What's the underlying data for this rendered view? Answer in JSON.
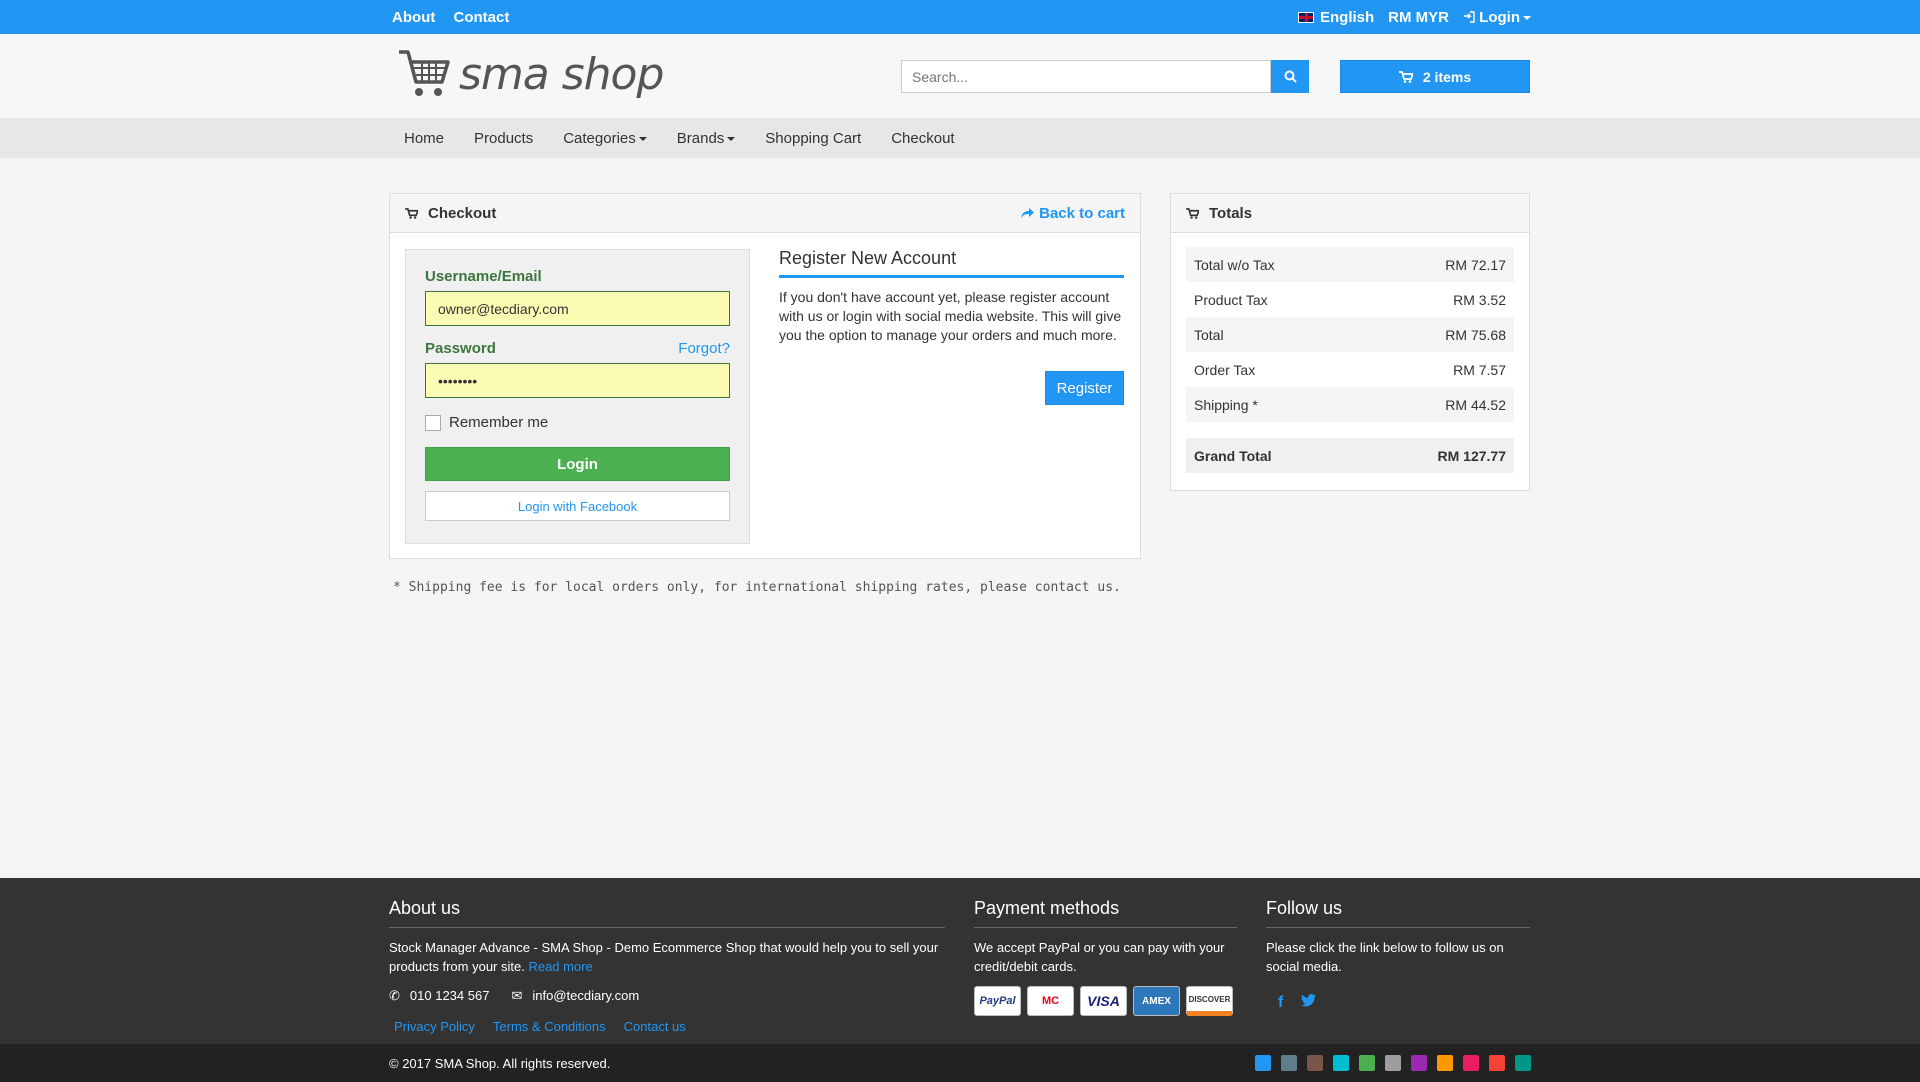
{
  "topbar": {
    "links": [
      "About",
      "Contact"
    ],
    "language": "English",
    "currency": "RM MYR",
    "login": "Login"
  },
  "header": {
    "logo_text": "sma shop",
    "search_placeholder": "Search...",
    "cart_label": "2 items"
  },
  "nav": {
    "items": [
      "Home",
      "Products",
      "Categories",
      "Brands",
      "Shopping Cart",
      "Checkout"
    ]
  },
  "checkout": {
    "title": "Checkout",
    "back_to_cart": "Back to cart",
    "username_label": "Username/Email",
    "username_value": "owner@tecdiary.com",
    "password_label": "Password",
    "forgot": "Forgot?",
    "password_value": "••••••••",
    "remember": "Remember me",
    "login_button": "Login",
    "facebook_button": "Login with Facebook",
    "register_title": "Register New Account",
    "register_text": "If you don't have account yet, please register account with us or login with social media website. This will give you the option to manage your orders and much more.",
    "register_button": "Register"
  },
  "totals": {
    "title": "Totals",
    "rows": [
      {
        "label": "Total w/o Tax",
        "value": "RM 72.17"
      },
      {
        "label": "Product Tax",
        "value": "RM 3.52"
      },
      {
        "label": "Total",
        "value": "RM 75.68"
      },
      {
        "label": "Order Tax",
        "value": "RM 7.57"
      },
      {
        "label": "Shipping *",
        "value": "RM 44.52"
      }
    ],
    "grand_label": "Grand Total",
    "grand_value": "RM 127.77"
  },
  "note": "* Shipping fee is for local orders only, for international shipping rates, please contact us.",
  "footer": {
    "about_title": "About us",
    "about_text": "Stock Manager Advance - SMA Shop - Demo Ecommerce Shop that would help you to sell your products from your site.",
    "read_more": "Read more",
    "phone": "010 1234 567",
    "email": "info@tecdiary.com",
    "links": [
      "Privacy Policy",
      "Terms & Conditions",
      "Contact us"
    ],
    "payment_title": "Payment methods",
    "payment_text": "We accept PayPal or you can pay with your credit/debit cards.",
    "cards": [
      "PayPal",
      "MC",
      "VISA",
      "AMEX",
      "DISCOVER"
    ],
    "follow_title": "Follow us",
    "follow_text": "Please click the link below to follow us on social media.",
    "copyright": "© 2017 SMA Shop. All rights reserved."
  },
  "theme_colors": [
    "#2196f3",
    "#607d8b",
    "#795548",
    "#00bcd4",
    "#4caf50",
    "#9e9e9e",
    "#9c27b0",
    "#ff9800",
    "#e91e63",
    "#f44336",
    "#009688"
  ]
}
